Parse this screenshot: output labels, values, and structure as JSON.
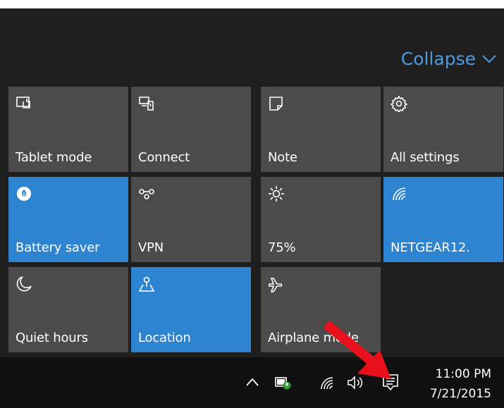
{
  "header": {
    "collapse_label": "Collapse",
    "collapse_icon": "chevron-down-icon"
  },
  "colors": {
    "accent": "#2d84d1",
    "tile_off": "#4b4b4b",
    "panel_bg": "#1f1f1f",
    "taskbar_bg": "#101010",
    "annotation_arrow": "#e8111b"
  },
  "tiles": [
    {
      "label": "Tablet mode",
      "icon": "tablet-mode-icon",
      "active": false
    },
    {
      "label": "Connect",
      "icon": "connect-icon",
      "active": false
    },
    {
      "label": "Note",
      "icon": "note-icon",
      "active": false
    },
    {
      "label": "All settings",
      "icon": "gear-icon",
      "active": false
    },
    {
      "label": "Battery saver",
      "icon": "battery-saver-icon",
      "active": true
    },
    {
      "label": "VPN",
      "icon": "vpn-icon",
      "active": false
    },
    {
      "label": "75%",
      "icon": "brightness-icon",
      "active": false
    },
    {
      "label": "NETGEAR12.",
      "icon": "wifi-icon",
      "active": true
    },
    {
      "label": "Quiet hours",
      "icon": "moon-icon",
      "active": false
    },
    {
      "label": "Location",
      "icon": "location-icon",
      "active": true
    },
    {
      "label": "Airplane mode",
      "icon": "airplane-icon",
      "active": false
    }
  ],
  "taskbar": {
    "time": "11:00 PM",
    "date": "7/21/2015",
    "tray_icons": [
      "chevron-up-icon",
      "power-icon",
      "wifi-icon",
      "volume-icon",
      "action-center-icon"
    ]
  }
}
